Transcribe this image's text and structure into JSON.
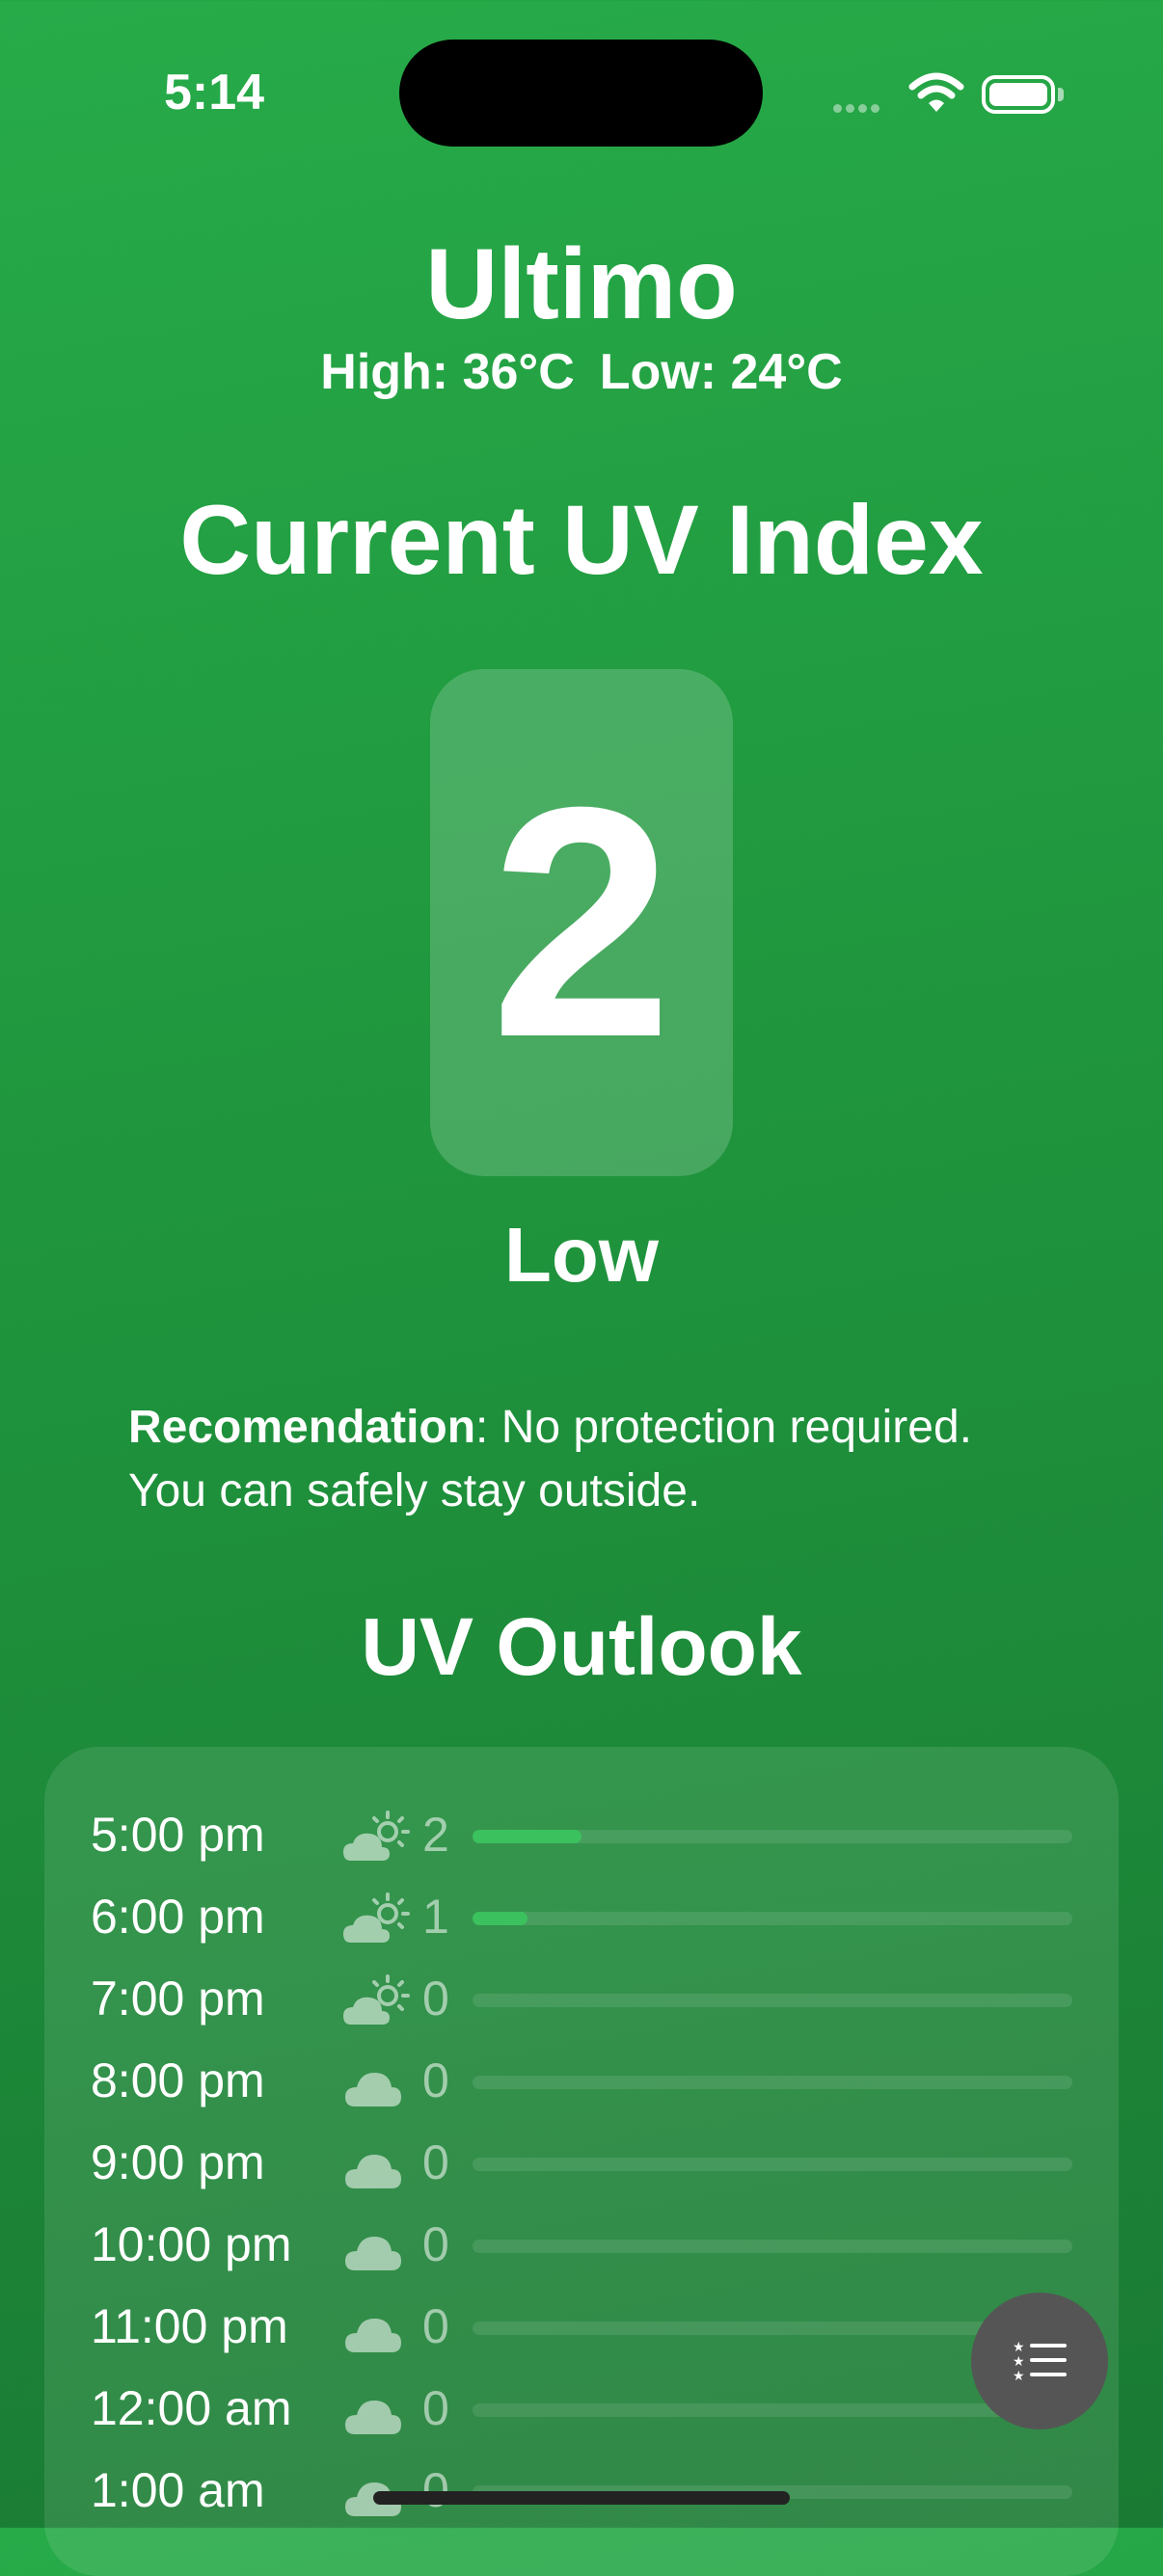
{
  "status_bar": {
    "time": "5:14"
  },
  "location": {
    "name": "Ultimo",
    "high": "High: 36°C",
    "low": "Low: 24°C"
  },
  "current": {
    "title": "Current UV Index",
    "uv_index": "2",
    "level": "Low"
  },
  "recommendation": {
    "label": "Recomendation",
    "text": ": No protection required. You can safely stay outside."
  },
  "outlook": {
    "title": "UV Outlook",
    "max_uv_scale": 11,
    "bar_color": "#3bc15d",
    "rows": [
      {
        "time": "5:00 pm",
        "icon": "cloud-sun-icon",
        "uv": 2
      },
      {
        "time": "6:00 pm",
        "icon": "cloud-sun-icon",
        "uv": 1
      },
      {
        "time": "7:00 pm",
        "icon": "cloud-sun-icon",
        "uv": 0
      },
      {
        "time": "8:00 pm",
        "icon": "cloud-icon",
        "uv": 0
      },
      {
        "time": "9:00 pm",
        "icon": "cloud-icon",
        "uv": 0
      },
      {
        "time": "10:00 pm",
        "icon": "cloud-icon",
        "uv": 0
      },
      {
        "time": "11:00 pm",
        "icon": "cloud-icon",
        "uv": 0
      },
      {
        "time": "12:00 am",
        "icon": "cloud-icon",
        "uv": 0
      },
      {
        "time": "1:00 am",
        "icon": "cloud-icon",
        "uv": 0
      }
    ]
  },
  "colors": {
    "background": "#22a045",
    "fab": "#555555"
  }
}
